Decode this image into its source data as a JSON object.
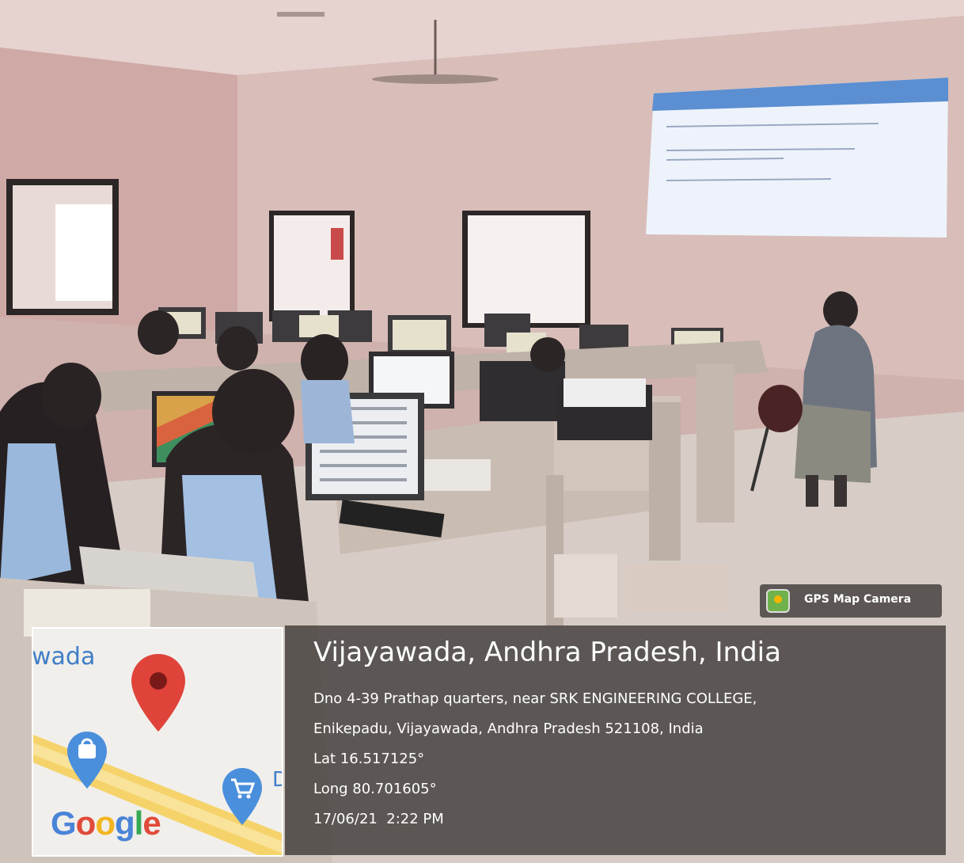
{
  "map": {
    "city_fragment": "wada",
    "clip_letter": "D",
    "logo": "Google"
  },
  "stamp": {
    "app_name": "GPS Map Camera",
    "app_icon": "gps-map-camera-icon",
    "place": "Vijayawada, Andhra Pradesh, India",
    "address_line1": "Dno 4-39 Prathap quarters, near SRK ENGINEERING COLLEGE,",
    "address_line2": "Enikepadu, Vijayawada, Andhra Pradesh 521108, India",
    "lat": "Lat 16.517125°",
    "long": "Long 80.701605°",
    "datetime": "17/06/21  2:22 PM"
  },
  "colors": {
    "wall": "#d7b9b5",
    "info_panel": "#2c2928",
    "map_pin": "#e0433a",
    "poi_pin": "#4a8fdc"
  }
}
